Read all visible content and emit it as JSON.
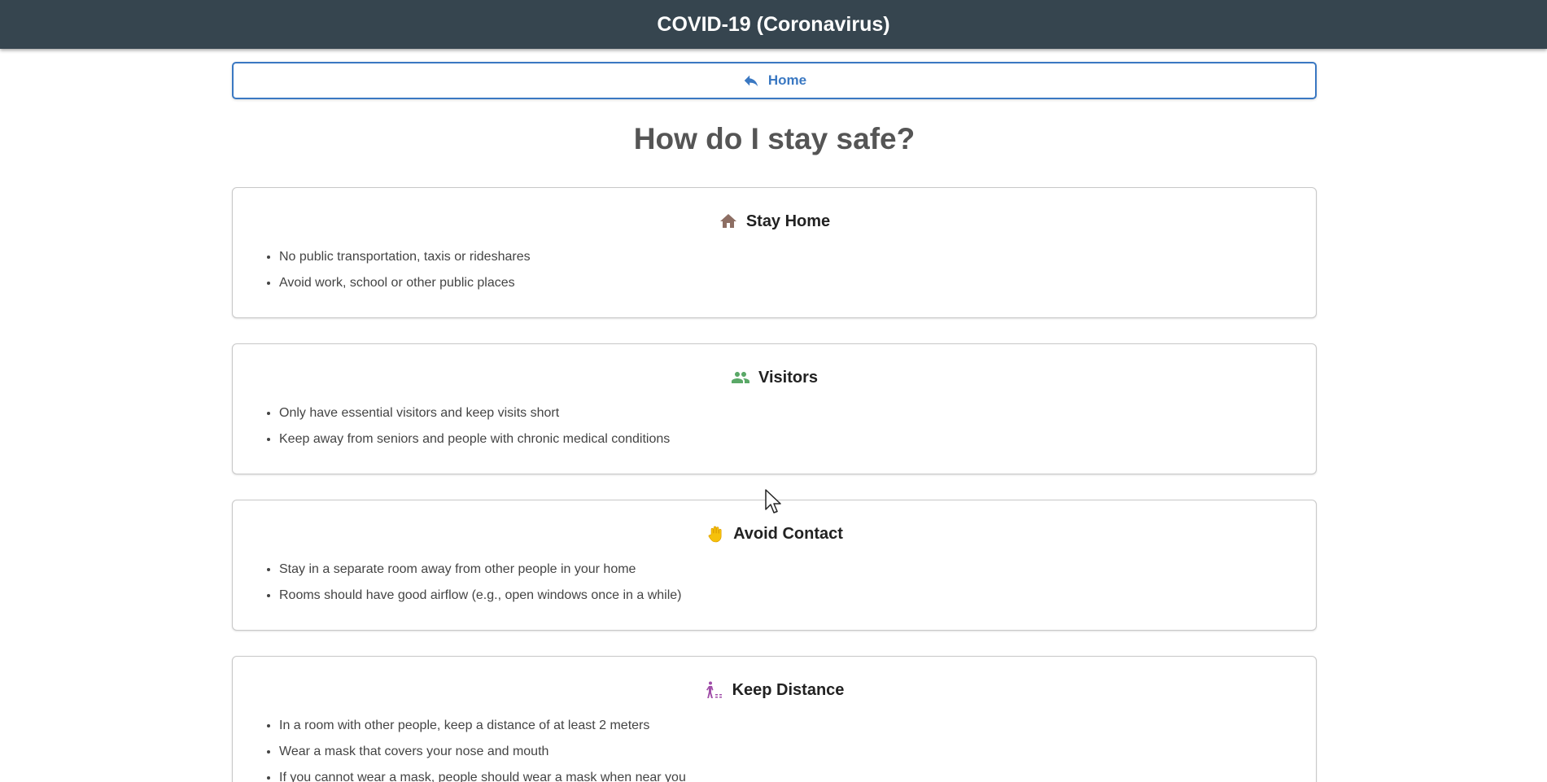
{
  "header": {
    "title": "COVID-19 (Coronavirus)"
  },
  "nav": {
    "home_label": "Home",
    "home_icon": "reply-arrow-icon"
  },
  "page": {
    "title": "How do I stay safe?"
  },
  "cards": [
    {
      "title": "Stay Home",
      "icon": "house-icon",
      "icon_color": "#8d6e63",
      "items": [
        "No public transportation, taxis or rideshares",
        "Avoid work, school or other public places"
      ]
    },
    {
      "title": "Visitors",
      "icon": "people-icon",
      "icon_color": "#5aa867",
      "items": [
        "Only have essential visitors and keep visits short",
        "Keep away from seniors and people with chronic medical conditions"
      ]
    },
    {
      "title": "Avoid Contact",
      "icon": "raised-hand-icon",
      "icon_color": "#f6c10a",
      "items": [
        "Stay in a separate room away from other people in your home",
        "Rooms should have good airflow (e.g., open windows once in a while)"
      ]
    },
    {
      "title": "Keep Distance",
      "icon": "social-distance-icon",
      "icon_color": "#a04ea8",
      "items": [
        "In a room with other people, keep a distance of at least 2 meters",
        "Wear a mask that covers your nose and mouth",
        "If you cannot wear a mask, people should wear a mask when near you"
      ]
    }
  ]
}
